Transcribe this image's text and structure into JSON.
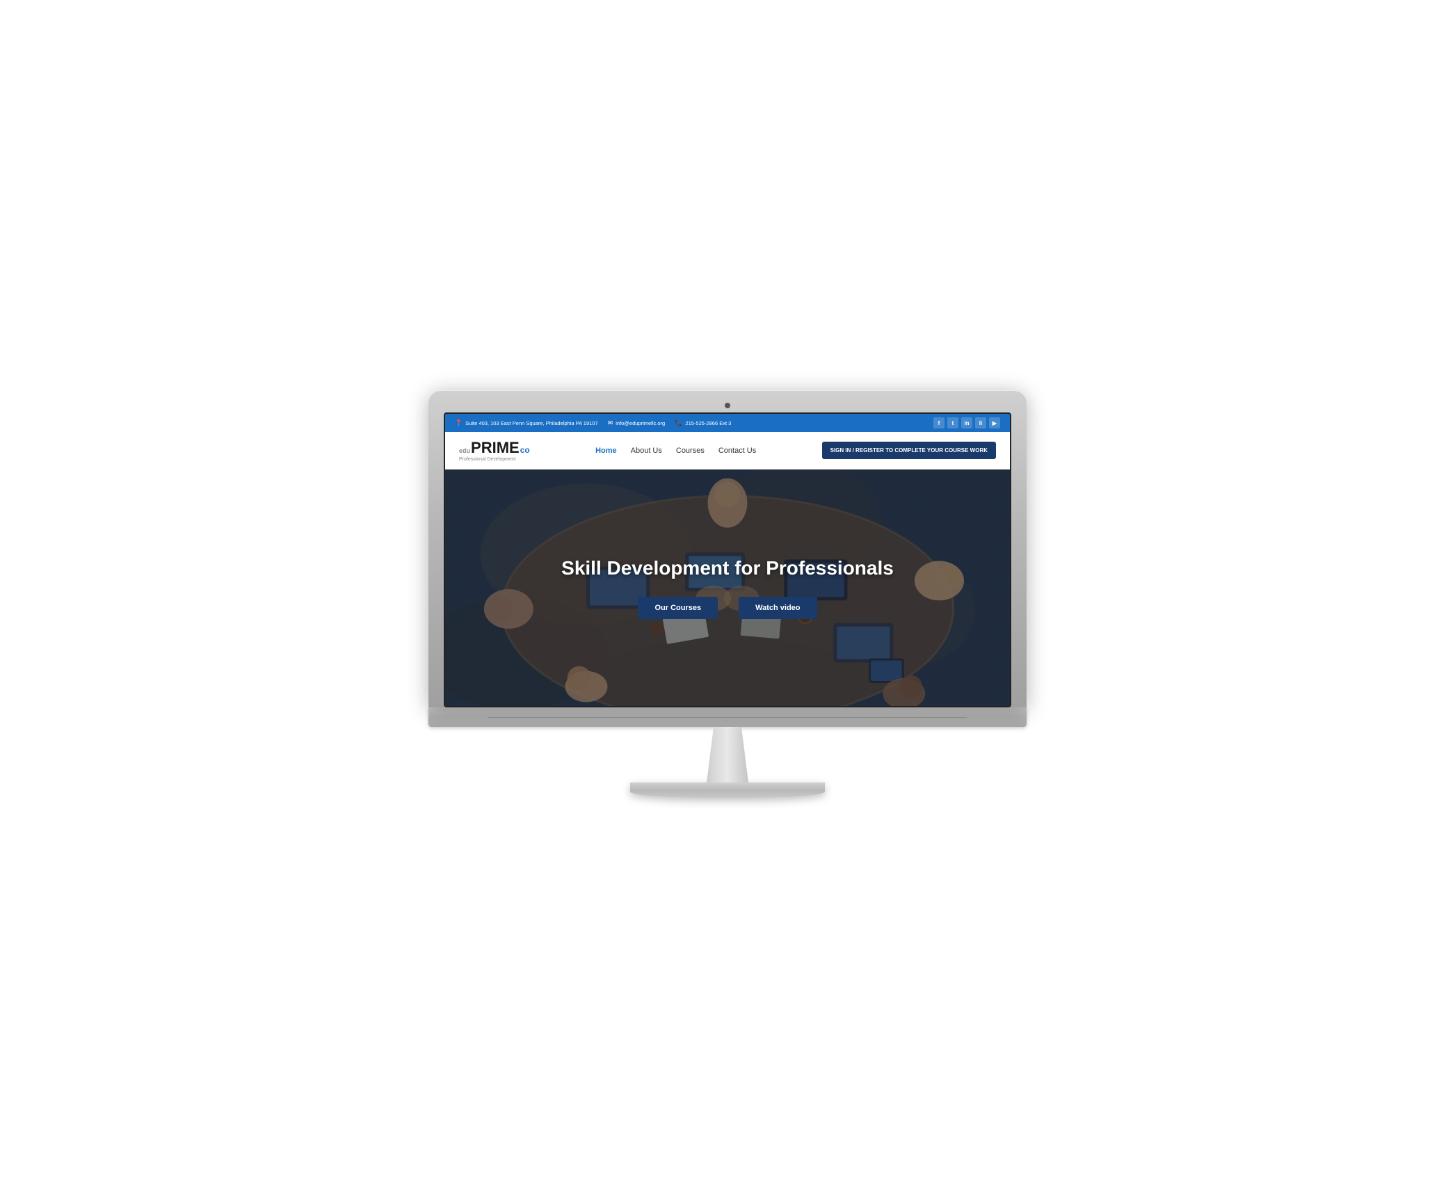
{
  "topbar": {
    "address": "Suite 403, 103 East Penn Square, Philadelphia PA 19107",
    "email": "info@eduprimellc.org",
    "phone": "215-525-2866 Ext 3",
    "social": [
      "f",
      "t",
      "in",
      "li",
      "yt"
    ]
  },
  "navbar": {
    "logo_edu": "edu",
    "logo_prime": "PRIME",
    "logo_co": "co",
    "logo_tagline": "Professional Development",
    "nav_home": "Home",
    "nav_about": "About Us",
    "nav_courses": "Courses",
    "nav_contact": "Contact Us",
    "cta_button": "SIGN IN / REGISTER TO COMPLETE YOUR COURSE WORK"
  },
  "hero": {
    "title": "Skill Development for Professionals",
    "btn_courses": "Our Courses",
    "btn_video": "Watch video"
  },
  "colors": {
    "blue_primary": "#1a6fc4",
    "blue_dark": "#1a3a6c",
    "nav_active": "#1a6fc4"
  }
}
